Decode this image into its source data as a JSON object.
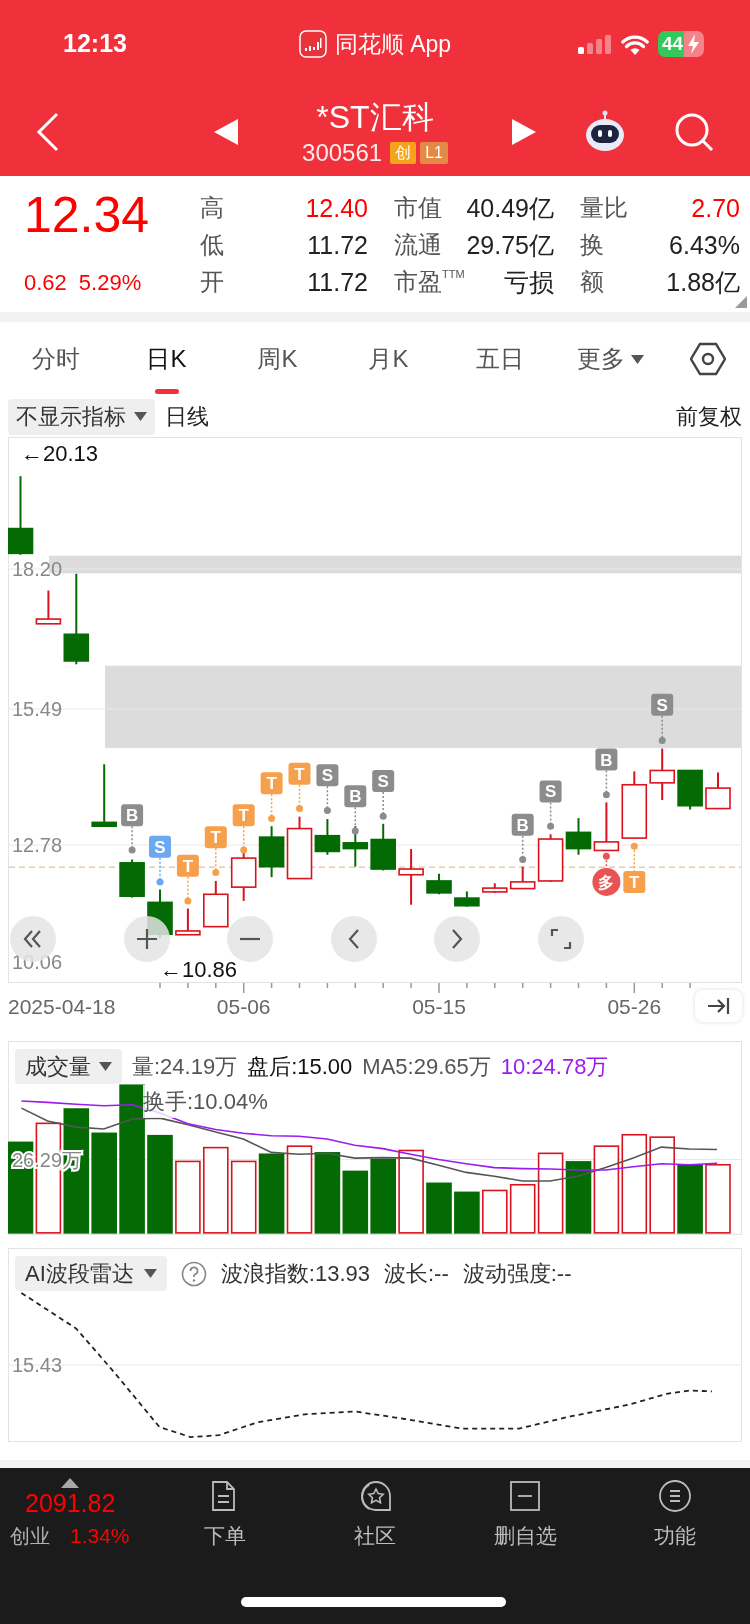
{
  "status_bar": {
    "time": "12:13",
    "app_name": "同花顺 App",
    "battery": "44"
  },
  "header": {
    "title": "*ST汇科",
    "code": "300561",
    "badges": [
      {
        "label": "创",
        "color": "#f7a21b"
      },
      {
        "label": "L1",
        "color": "#e38b45"
      }
    ]
  },
  "quote": {
    "price": "12.34",
    "change": "0.62",
    "change_pct": "5.29%",
    "stats": [
      {
        "label": "高",
        "value": "12.40",
        "color": "#ff0000"
      },
      {
        "label": "市值",
        "value": "40.49亿",
        "color": "#222222"
      },
      {
        "label": "量比",
        "value": "2.70",
        "color": "#ff0000"
      },
      {
        "label": "低",
        "value": "11.72",
        "color": "#222222"
      },
      {
        "label": "流通",
        "value": "29.75亿",
        "color": "#222222"
      },
      {
        "label": "换",
        "value": "6.43%",
        "color": "#222222"
      },
      {
        "label": "开",
        "value": "11.72",
        "color": "#222222"
      },
      {
        "label": "市盈$^{TTM}$",
        "value": "亏损",
        "color": "#222222"
      },
      {
        "label": "额",
        "value": "1.88亿",
        "color": "#222222"
      }
    ]
  },
  "tabs": [
    {
      "label": "分时",
      "selected": false,
      "kind": "tab"
    },
    {
      "label": "日K",
      "selected": true,
      "kind": "tab"
    },
    {
      "label": "周K",
      "selected": false,
      "kind": "tab"
    },
    {
      "label": "月K",
      "selected": false,
      "kind": "tab"
    },
    {
      "label": "五日",
      "selected": false,
      "kind": "tab"
    },
    {
      "label": "更多",
      "selected": false,
      "kind": "dropdown"
    }
  ],
  "indicator_bar": {
    "indicator": "不显示指标",
    "period": "日线",
    "adjustment": "前复权"
  },
  "kline": {
    "axis_labels": [
      "18.20",
      "15.49",
      "12.78",
      "10.06"
    ],
    "high_marker": "←20.13",
    "low_marker": "←10.86",
    "signals": [
      {
        "label": "B",
        "kind": "tag",
        "color": "#8c8c8c"
      },
      {
        "label": "S",
        "kind": "tag",
        "color": "#6aa8f0"
      },
      {
        "label": "T",
        "kind": "tag",
        "color": "#f7a04c"
      },
      {
        "label": "T",
        "kind": "tag",
        "color": "#f7a04c"
      },
      {
        "label": "T",
        "kind": "tag",
        "color": "#f7a04c"
      },
      {
        "label": "T",
        "kind": "tag",
        "color": "#f7a04c"
      },
      {
        "label": "T",
        "kind": "tag",
        "color": "#f7a04c"
      },
      {
        "label": "S",
        "kind": "tag",
        "color": "#8c8c8c"
      },
      {
        "label": "B",
        "kind": "tag",
        "color": "#8c8c8c"
      },
      {
        "label": "S",
        "kind": "tag",
        "color": "#8c8c8c"
      },
      {
        "label": "B",
        "kind": "tag",
        "color": "#8c8c8c"
      },
      {
        "label": "S",
        "kind": "tag",
        "color": "#8c8c8c"
      },
      {
        "label": "B",
        "kind": "tag",
        "color": "#8c8c8c"
      },
      {
        "label": "多",
        "kind": "circle",
        "color": "#e85454"
      },
      {
        "label": "T",
        "kind": "tag",
        "color": "#f7a04c"
      },
      {
        "label": "S",
        "kind": "tag",
        "color": "#8c8c8c"
      }
    ],
    "dates": [
      "2025-04-18",
      "05-06",
      "05-15",
      "05-26"
    ]
  },
  "volume": {
    "selector": "成交量",
    "readings": [
      {
        "text": "量:24.19万",
        "color": "#555555"
      },
      {
        "text": "盘后:15.00",
        "color": "#111111"
      },
      {
        "text": "MA5:29.65万",
        "color": "#555555"
      },
      {
        "text": "10:24.78万",
        "color": "#9a1cf0"
      }
    ],
    "turnover": "换手:10.04%",
    "axis_label": "26.29万"
  },
  "ai_radar": {
    "selector": "AI波段雷达",
    "readings": [
      "波浪指数:13.93",
      "波长:--",
      "波动强度:--"
    ],
    "axis_label": "15.43"
  },
  "index_ticker": {
    "value": "2091.82",
    "name": "创业",
    "change_pct": "1.34%"
  },
  "bottom_nav": [
    {
      "label": "下单",
      "kind": "order"
    },
    {
      "label": "社区",
      "kind": "community"
    },
    {
      "label": "删自选",
      "kind": "remove"
    },
    {
      "label": "功能",
      "kind": "menu"
    }
  ]
}
